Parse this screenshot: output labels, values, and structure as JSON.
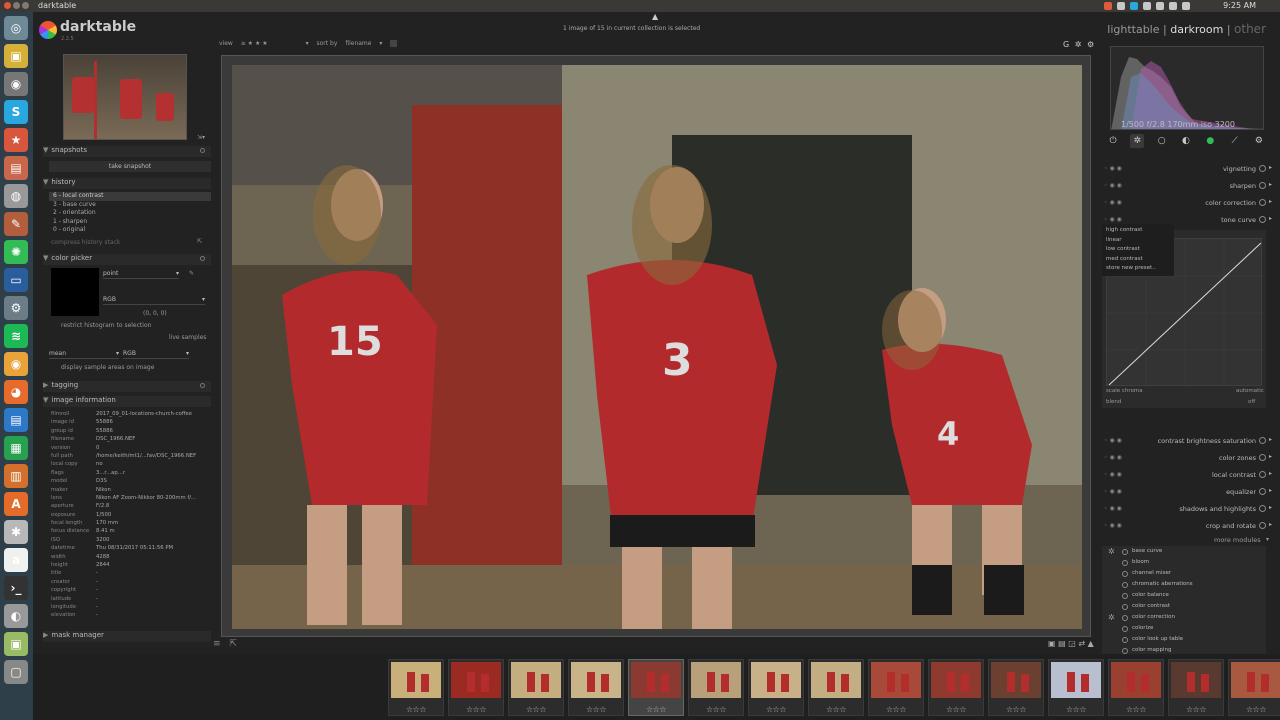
{
  "os": {
    "window_title": "darktable",
    "clock": "9:25 AM"
  },
  "launcher": {
    "items": [
      {
        "icon": "ubuntu-dash-icon",
        "glyph": "◎",
        "color": "#6f8a96"
      },
      {
        "icon": "monitor-icon",
        "glyph": "▣",
        "color": "#d6b13a"
      },
      {
        "icon": "camera-icon",
        "glyph": "◉",
        "color": "#777"
      },
      {
        "icon": "skype-icon",
        "glyph": "S",
        "color": "#29a8e0"
      },
      {
        "icon": "star-icon",
        "glyph": "★",
        "color": "#d9553e"
      },
      {
        "icon": "files-icon",
        "glyph": "▤",
        "color": "#c8674a"
      },
      {
        "icon": "disk-icon",
        "glyph": "◍",
        "color": "#999"
      },
      {
        "icon": "pencil-icon",
        "glyph": "✎",
        "color": "#b35e3c"
      },
      {
        "icon": "darktable-icon",
        "glyph": "✺",
        "color": "#3b5"
      },
      {
        "icon": "terminal-icon",
        "glyph": "▭",
        "color": "#2a5d9c"
      },
      {
        "icon": "gear-icon",
        "glyph": "⚙",
        "color": "#6d7d88"
      },
      {
        "icon": "spotify-icon",
        "glyph": "≋",
        "color": "#1db954"
      },
      {
        "icon": "chrome-icon",
        "glyph": "◉",
        "color": "#e8a33a"
      },
      {
        "icon": "firefox-icon",
        "glyph": "◕",
        "color": "#e76b2c"
      },
      {
        "icon": "writer-icon",
        "glyph": "▤",
        "color": "#2e78c8"
      },
      {
        "icon": "calc-icon",
        "glyph": "▦",
        "color": "#27a150"
      },
      {
        "icon": "impress-icon",
        "glyph": "▥",
        "color": "#d2702c"
      },
      {
        "icon": "software-center-icon",
        "glyph": "A",
        "color": "#e56b2a"
      },
      {
        "icon": "settings-icon",
        "glyph": "✱",
        "color": "#b8b8b8"
      },
      {
        "icon": "amazon-icon",
        "glyph": "a",
        "color": "#f0f0f0"
      },
      {
        "icon": "terminal-icon-2",
        "glyph": "›_",
        "color": "#333"
      },
      {
        "icon": "disc-icon",
        "glyph": "◐",
        "color": "#999"
      },
      {
        "icon": "file-roller-icon",
        "glyph": "▣",
        "color": "#9b6"
      },
      {
        "icon": "trash-icon",
        "glyph": "▢",
        "color": "#888"
      }
    ]
  },
  "app": {
    "logo": "darktable",
    "version": "2.2.5",
    "views": {
      "lighttable": "lighttable",
      "sep": "|",
      "darkroom": "darkroom",
      "sep2": "|",
      "other": "other"
    },
    "collection_info": "1 image of 15 in current collection is selected",
    "filter": {
      "view_label": "view",
      "rating": "≥ ★ ★ ★",
      "sort_label": "sort by",
      "sort_value": "filename"
    }
  },
  "left": {
    "snapshots": {
      "title": "snapshots",
      "button": "take snapshot"
    },
    "history": {
      "title": "history",
      "items": [
        "6 - local contrast",
        "3 - base curve",
        "2 - orientation",
        "1 - sharpen",
        "0 - original"
      ],
      "compress": "compress history stack"
    },
    "color_picker": {
      "title": "color picker",
      "mode": "point",
      "model": "RGB",
      "values": "(0, 0, 0)",
      "restrict": "restrict histogram to selection",
      "live_samples": "live samples",
      "stat": "mean",
      "stat_model": "RGB",
      "display_areas": "display sample areas on image"
    },
    "tagging": {
      "title": "tagging"
    },
    "image_info": {
      "title": "image information",
      "rows": [
        [
          "filmroll",
          "2017_09_01-locations-church-coffee"
        ],
        [
          "image id",
          "55886"
        ],
        [
          "group id",
          "55886"
        ],
        [
          "filename",
          "DSC_1966.NEF"
        ],
        [
          "version",
          "0"
        ],
        [
          "full path",
          "/home/keith/mt1/...fav/DSC_1966.NEF"
        ],
        [
          "local copy",
          "no"
        ],
        [
          "flags",
          "3...r...ap...r"
        ],
        [
          "model",
          "D3S"
        ],
        [
          "maker",
          "Nikon"
        ],
        [
          "lens",
          "Nikon AF Zoom-Nikkor 80-200mm f/..."
        ],
        [
          "aperture",
          "F/2.8"
        ],
        [
          "exposure",
          "1/500"
        ],
        [
          "focal length",
          "170 mm"
        ],
        [
          "focus distance",
          "8.41 m"
        ],
        [
          "ISO",
          "3200"
        ],
        [
          "datetime",
          "Thu 08/31/2017 05:11:56 PM"
        ],
        [
          "width",
          "4288"
        ],
        [
          "height",
          "2844"
        ],
        [
          "title",
          "-"
        ],
        [
          "creator",
          "-"
        ],
        [
          "copyright",
          "-"
        ],
        [
          "latitude",
          "-"
        ],
        [
          "longitude",
          "-"
        ],
        [
          "elevation",
          "-"
        ]
      ]
    },
    "mask_manager": {
      "title": "mask manager"
    }
  },
  "right": {
    "histogram_exif": "1/500 f/2.8 170mm iso 3200",
    "modules": [
      {
        "name": "vignetting"
      },
      {
        "name": "sharpen"
      },
      {
        "name": "color correction"
      },
      {
        "name": "tone curve"
      }
    ],
    "tone_curve": {
      "presets": [
        "high contrast",
        "linear",
        "low contrast",
        "med contrast",
        "store new preset.."
      ],
      "scale_label": "scale chroma",
      "scale_value": "automatic",
      "blend_label": "blend",
      "blend_value": "off"
    },
    "modules2": [
      {
        "name": "contrast brightness saturation"
      },
      {
        "name": "color zones"
      },
      {
        "name": "local contrast"
      },
      {
        "name": "equalizer"
      },
      {
        "name": "shadows and highlights"
      },
      {
        "name": "crop and rotate"
      }
    ],
    "more_modules": "more modules",
    "favorites": [
      "base curve",
      "bloom",
      "channel mixer",
      "chromatic aberrations",
      "color balance",
      "color contrast",
      "color correction",
      "colorize",
      "color look up table",
      "color mapping"
    ]
  },
  "filmstrip": {
    "stars": "☆☆☆",
    "count": 15
  }
}
